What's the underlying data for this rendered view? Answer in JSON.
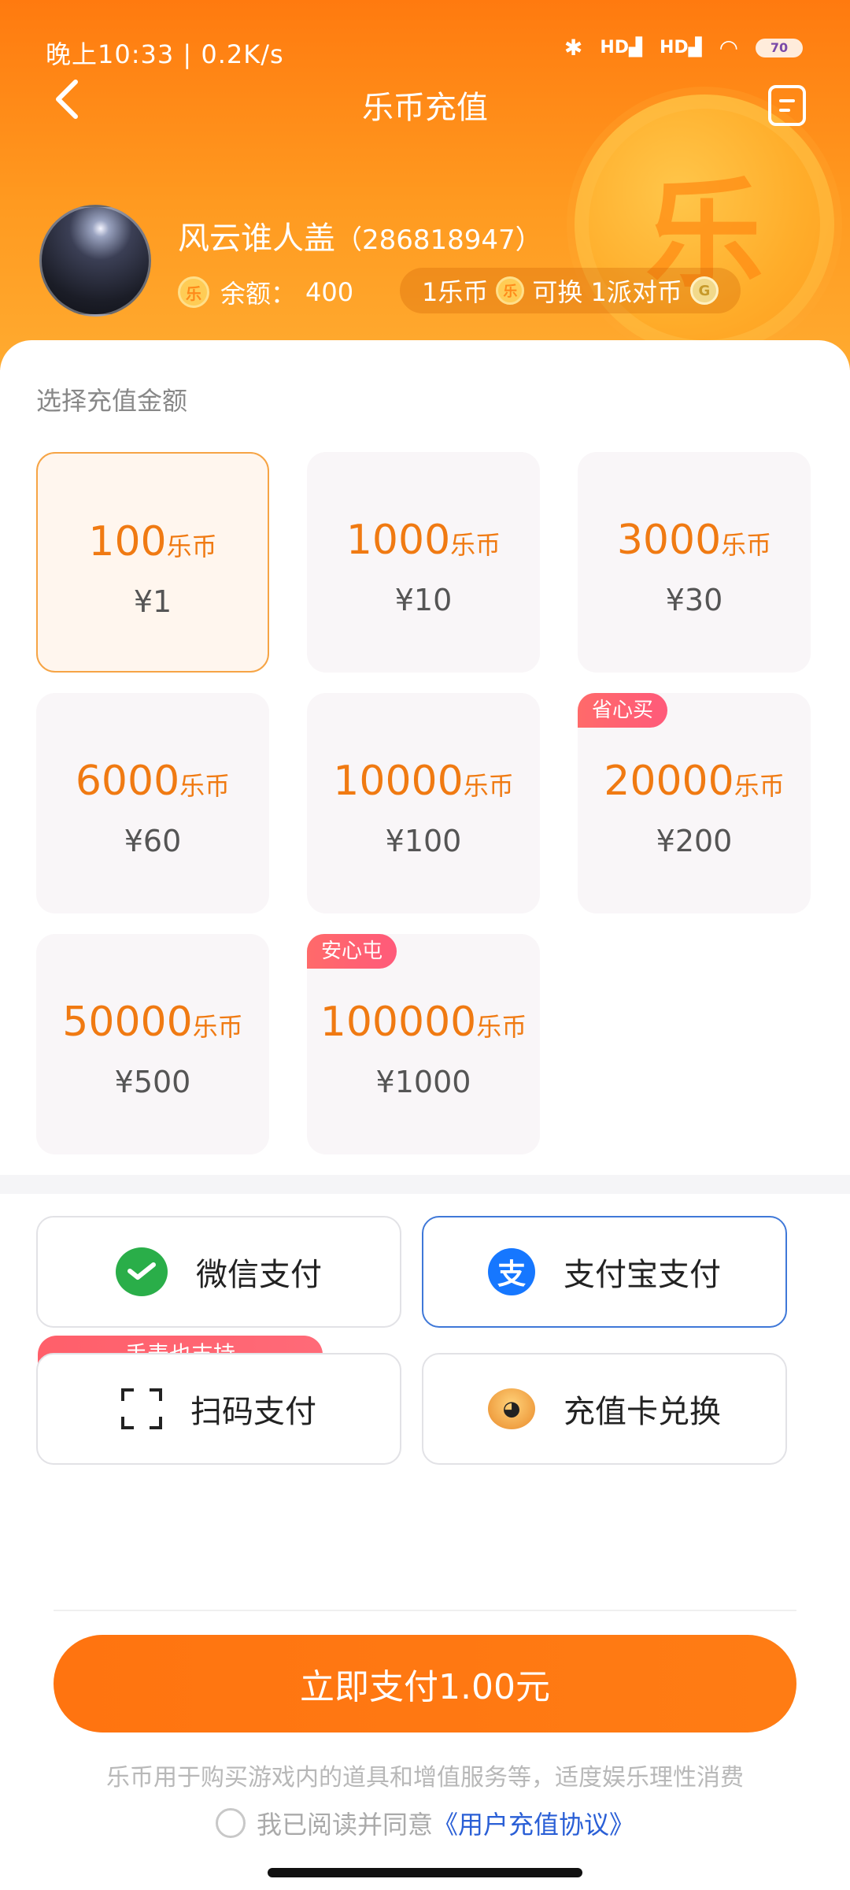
{
  "status_bar": {
    "left_text": "晚上10:33 | 0.2K/s",
    "right_text_hd1": "HD",
    "right_text_hd2": "HD",
    "battery": "70"
  },
  "nav": {
    "title": "乐币充值",
    "back_icon": "chevron-left-icon",
    "menu_icon": "record-list-icon"
  },
  "user": {
    "name": "风云谁人盖",
    "uid": "（286818947）",
    "balance_label": "余额：",
    "balance_value": "400",
    "rate_text_1": "1乐币",
    "rate_text_2": "可换 1派对币",
    "coin_glyph": "乐"
  },
  "recharge": {
    "section_title": "选择充值金额",
    "options": [
      {
        "coins": "100",
        "unit": "乐币",
        "price": "¥1",
        "tag": ""
      },
      {
        "coins": "1000",
        "unit": "乐币",
        "price": "¥10",
        "tag": ""
      },
      {
        "coins": "3000",
        "unit": "乐币",
        "price": "¥30",
        "tag": ""
      },
      {
        "coins": "6000",
        "unit": "乐币",
        "price": "¥60",
        "tag": ""
      },
      {
        "coins": "10000",
        "unit": "乐币",
        "price": "¥100",
        "tag": ""
      },
      {
        "coins": "20000",
        "unit": "乐币",
        "price": "¥200",
        "tag": "省心买"
      },
      {
        "coins": "50000",
        "unit": "乐币",
        "price": "¥500",
        "tag": ""
      },
      {
        "coins": "100000",
        "unit": "乐币",
        "price": "¥1000",
        "tag": "安心屯"
      }
    ],
    "selected_index": 0
  },
  "payment": {
    "methods": [
      {
        "label": "微信支付",
        "icon": "wechat-pay-icon"
      },
      {
        "label": "支付宝支付",
        "icon": "alipay-icon",
        "selected": true
      },
      {
        "label": "扫码支付",
        "icon": "scan-icon",
        "badge": "手表也支持"
      },
      {
        "label": "充值卡兑换",
        "icon": "recharge-card-icon"
      }
    ],
    "alipay_glyph": "支"
  },
  "footer": {
    "pay_button": "立即支付1.00元",
    "notice": "乐币用于购买游戏内的道具和增值服务等，适度娱乐理性消费",
    "agree_prefix": "我已阅读并同意",
    "agree_link": "《用户充值协议》"
  },
  "colors": {
    "accent": "#ff7410",
    "coin_text": "#f07a12",
    "selected_pay_border": "#3f78d8"
  }
}
